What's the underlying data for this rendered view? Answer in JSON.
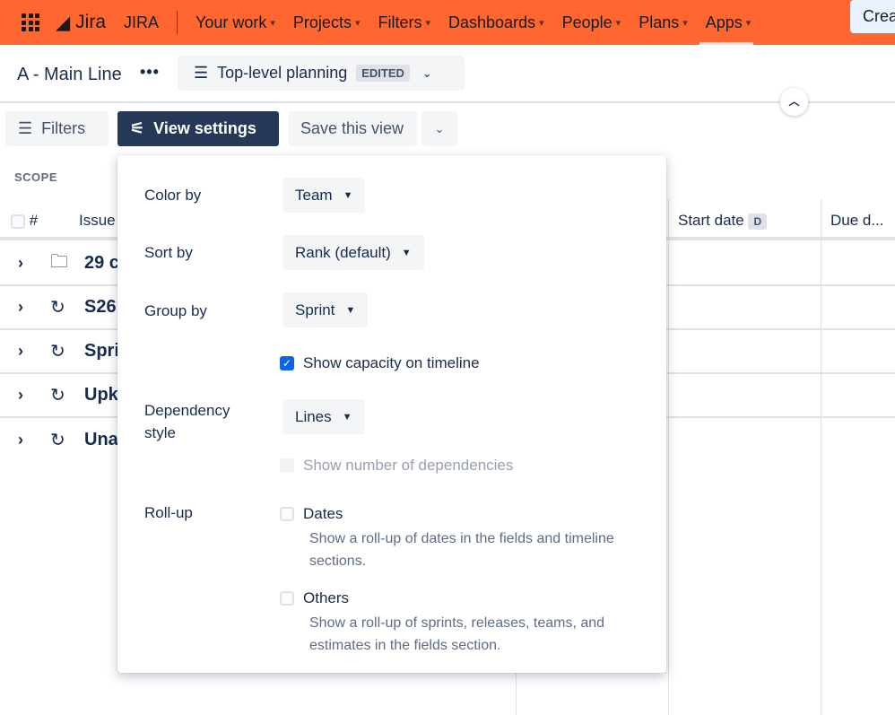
{
  "nav": {
    "product": "Jira",
    "site": "JIRA",
    "items": [
      "Your work",
      "Projects",
      "Filters",
      "Dashboards",
      "People",
      "Plans",
      "Apps"
    ],
    "create": "Create"
  },
  "plan": {
    "title": "A - Main Line",
    "view_name": "Top-level planning",
    "view_badge": "EDITED"
  },
  "toolbar": {
    "filters": "Filters",
    "view_settings": "View settings",
    "save_view": "Save this view"
  },
  "scope": {
    "label": "SCOPE",
    "col_hash": "#",
    "col_issue": "Issue",
    "col_start": "Start date",
    "start_badge": "D",
    "col_due": "Due d..."
  },
  "rows": [
    {
      "icon": "folder-icon",
      "label": "29 c"
    },
    {
      "icon": "sprint-icon",
      "label": "S26"
    },
    {
      "icon": "sprint-icon",
      "label": "Spri"
    },
    {
      "icon": "sprint-icon",
      "label": "Upk"
    },
    {
      "icon": "sprint-icon",
      "label": "Una"
    }
  ],
  "settings": {
    "color_by": {
      "label": "Color by",
      "value": "Team"
    },
    "sort_by": {
      "label": "Sort by",
      "value": "Rank (default)"
    },
    "group_by": {
      "label": "Group by",
      "value": "Sprint"
    },
    "show_capacity": {
      "label": "Show capacity on timeline",
      "checked": true
    },
    "dependency_style": {
      "label": "Dependency style",
      "value": "Lines"
    },
    "show_dep_count": {
      "label": "Show number of dependencies",
      "checked": false,
      "disabled": true
    },
    "rollup": {
      "label": "Roll-up",
      "dates": {
        "label": "Dates",
        "desc": "Show a roll-up of dates in the fields and timeline sections.",
        "checked": false
      },
      "others": {
        "label": "Others",
        "desc": "Show a roll-up of sprints, releases, teams, and estimates in the fields section.",
        "checked": false
      }
    }
  }
}
